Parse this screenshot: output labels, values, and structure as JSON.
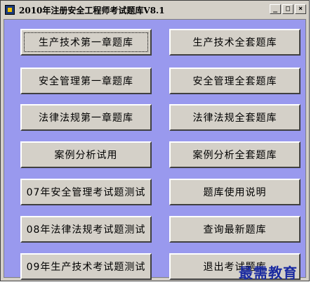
{
  "window": {
    "title": "2010年注册安全工程师考试题库V8.1",
    "controls": {
      "minimize": "_",
      "maximize": "□",
      "close": "×"
    }
  },
  "buttons": {
    "left": [
      "生产技术第一章题库",
      "安全管理第一章题库",
      "法律法规第一章题库",
      "案例分析试用",
      "07年安全管理考试题测试",
      "08年法律法规考试题测试",
      "09年生产技术考试题测试"
    ],
    "right": [
      "生产技术全套题库",
      "安全管理全套题库",
      "法律法规全套题库",
      "案例分析全套题库",
      "题库使用说明",
      "查询最新题库",
      "退出考试题库"
    ]
  },
  "watermark": "最需教育",
  "colors": {
    "client_bg": "#9999ee",
    "button_face": "#d4d0c8",
    "watermark": "#1a2aa0"
  }
}
